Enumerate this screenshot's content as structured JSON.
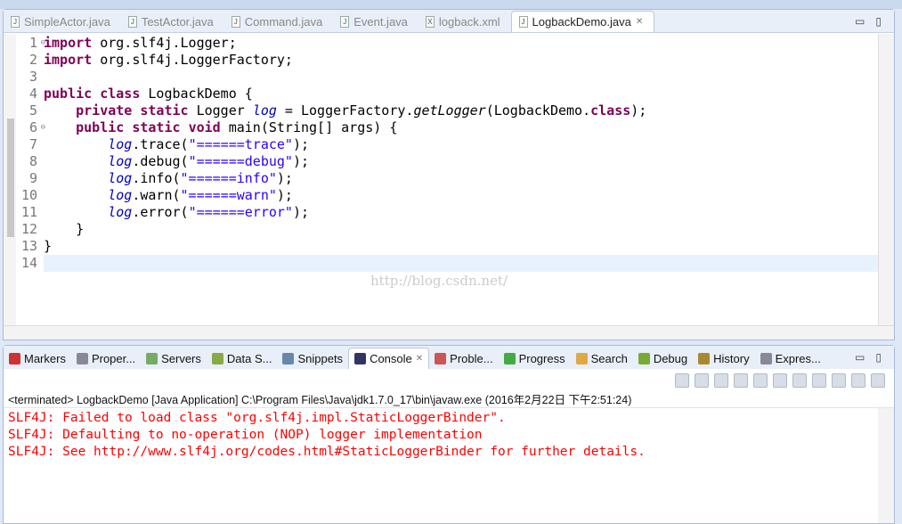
{
  "editor": {
    "tabs": [
      {
        "label": "SimpleActor.java",
        "icon": "J"
      },
      {
        "label": "TestActor.java",
        "icon": "J"
      },
      {
        "label": "Command.java",
        "icon": "J"
      },
      {
        "label": "Event.java",
        "icon": "J"
      },
      {
        "label": "logback.xml",
        "icon": "X"
      },
      {
        "label": "LogbackDemo.java",
        "icon": "J",
        "active": true,
        "close": "✕"
      }
    ],
    "minimize": "▭",
    "maximize": "▯",
    "current_line": 14,
    "lines": [
      [
        [
          "kw",
          "import"
        ],
        [
          "p",
          " org.slf4j.Logger;"
        ]
      ],
      [
        [
          "kw",
          "import"
        ],
        [
          "p",
          " org.slf4j.LoggerFactory;"
        ]
      ],
      [],
      [
        [
          "kw",
          "public"
        ],
        [
          "p",
          " "
        ],
        [
          "kw",
          "class"
        ],
        [
          "p",
          " LogbackDemo {"
        ]
      ],
      [
        [
          "p",
          "    "
        ],
        [
          "kw",
          "private"
        ],
        [
          "p",
          " "
        ],
        [
          "kw",
          "static"
        ],
        [
          "p",
          " Logger "
        ],
        [
          "fld",
          "log"
        ],
        [
          "p",
          " = LoggerFactory."
        ],
        [
          "sm",
          "getLogger"
        ],
        [
          "p",
          "(LogbackDemo."
        ],
        [
          "kw",
          "class"
        ],
        [
          "p",
          ");"
        ]
      ],
      [
        [
          "p",
          "    "
        ],
        [
          "kw",
          "public"
        ],
        [
          "p",
          " "
        ],
        [
          "kw",
          "static"
        ],
        [
          "p",
          " "
        ],
        [
          "kw",
          "void"
        ],
        [
          "p",
          " main(String[] args) {"
        ]
      ],
      [
        [
          "p",
          "        "
        ],
        [
          "fld",
          "log"
        ],
        [
          "p",
          ".trace("
        ],
        [
          "str",
          "\"======trace\""
        ],
        [
          "p",
          ");"
        ]
      ],
      [
        [
          "p",
          "        "
        ],
        [
          "fld",
          "log"
        ],
        [
          "p",
          ".debug("
        ],
        [
          "str",
          "\"======debug\""
        ],
        [
          "p",
          ");"
        ]
      ],
      [
        [
          "p",
          "        "
        ],
        [
          "fld",
          "log"
        ],
        [
          "p",
          ".info("
        ],
        [
          "str",
          "\"======info\""
        ],
        [
          "p",
          ");"
        ]
      ],
      [
        [
          "p",
          "        "
        ],
        [
          "fld",
          "log"
        ],
        [
          "p",
          ".warn("
        ],
        [
          "str",
          "\"======warn\""
        ],
        [
          "p",
          ");"
        ]
      ],
      [
        [
          "p",
          "        "
        ],
        [
          "fld",
          "log"
        ],
        [
          "p",
          ".error("
        ],
        [
          "str",
          "\"======error\""
        ],
        [
          "p",
          ");"
        ]
      ],
      [
        [
          "p",
          "    }"
        ]
      ],
      [
        [
          "p",
          "}"
        ]
      ],
      []
    ],
    "fold_lines": [
      1,
      6
    ],
    "watermark": "http://blog.csdn.net/"
  },
  "console": {
    "tabs": [
      {
        "label": "Markers",
        "color": "#c33"
      },
      {
        "label": "Proper...",
        "color": "#889"
      },
      {
        "label": "Servers",
        "color": "#7a6"
      },
      {
        "label": "Data S...",
        "color": "#8a4"
      },
      {
        "label": "Snippets",
        "color": "#68a"
      },
      {
        "label": "Console",
        "color": "#336",
        "active": true,
        "close": "✕"
      },
      {
        "label": "Proble...",
        "color": "#c55"
      },
      {
        "label": "Progress",
        "color": "#4a4"
      },
      {
        "label": "Search",
        "color": "#da4"
      },
      {
        "label": "Debug",
        "color": "#7a3"
      },
      {
        "label": "History",
        "color": "#a83"
      },
      {
        "label": "Expres...",
        "color": "#889"
      }
    ],
    "status": "<terminated> LogbackDemo [Java Application] C:\\Program Files\\Java\\jdk1.7.0_17\\bin\\javaw.exe (2016年2月22日 下午2:51:24)",
    "toolbar": [
      "terminate",
      "remove-launch",
      "remove-all",
      "clear-console",
      "scroll-lock",
      "word-wrap",
      "show-on-stdout",
      "show-on-stderr",
      "pin-console",
      "display-selected-console",
      "open-console"
    ],
    "output": [
      "SLF4J: Failed to load class \"org.slf4j.impl.StaticLoggerBinder\".",
      "SLF4J: Defaulting to no-operation (NOP) logger implementation",
      "SLF4J: See http://www.slf4j.org/codes.html#StaticLoggerBinder for further details."
    ],
    "output_color": "#ff0000"
  }
}
